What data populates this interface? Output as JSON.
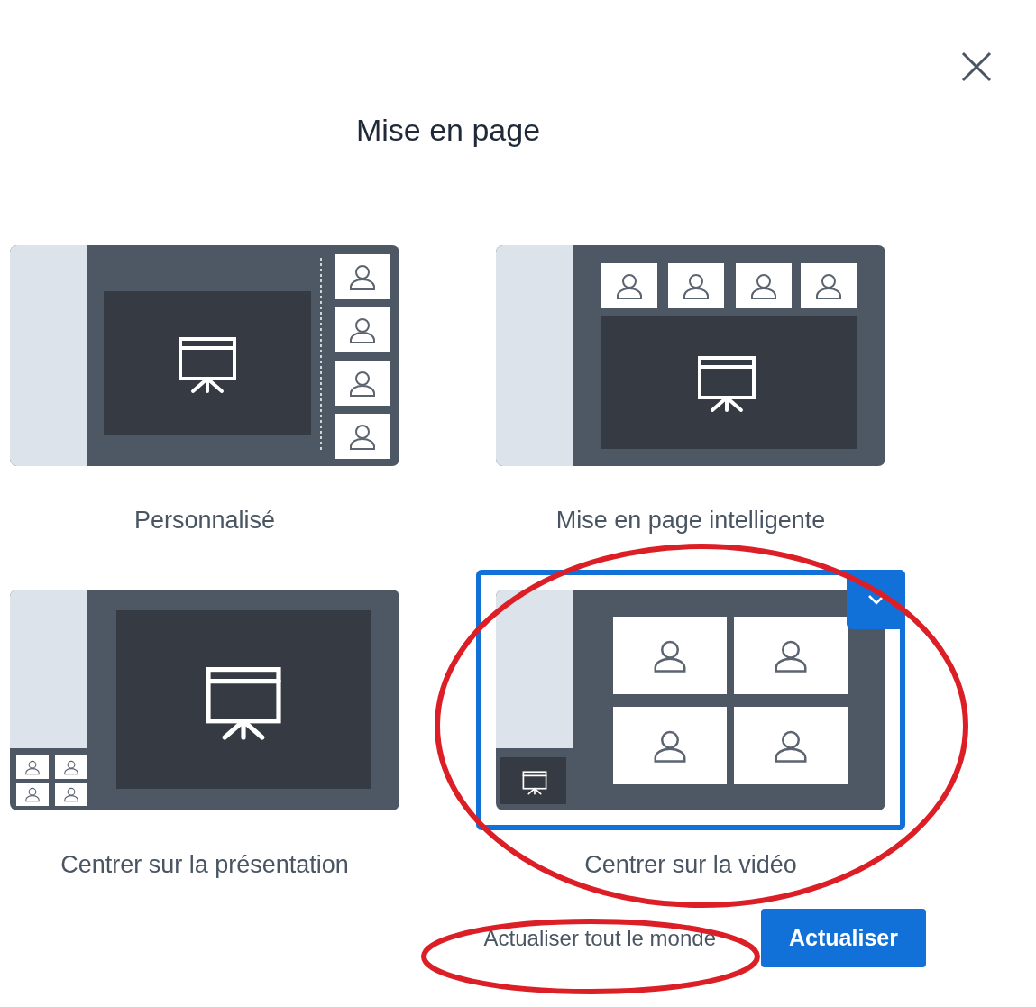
{
  "dialog": {
    "title": "Mise en page"
  },
  "layouts": [
    {
      "kind": "custom",
      "label": "Personnalisé",
      "selected": false
    },
    {
      "kind": "smart",
      "label": "Mise en page intelligente",
      "selected": false
    },
    {
      "kind": "presentation",
      "label": "Centrer sur la présentation",
      "selected": false
    },
    {
      "kind": "video",
      "label": "Centrer sur la vidéo",
      "selected": true
    }
  ],
  "buttons": [
    {
      "kind": "secondary",
      "label": "Actualiser tout le monde"
    },
    {
      "kind": "primary",
      "label": "Actualiser"
    }
  ]
}
